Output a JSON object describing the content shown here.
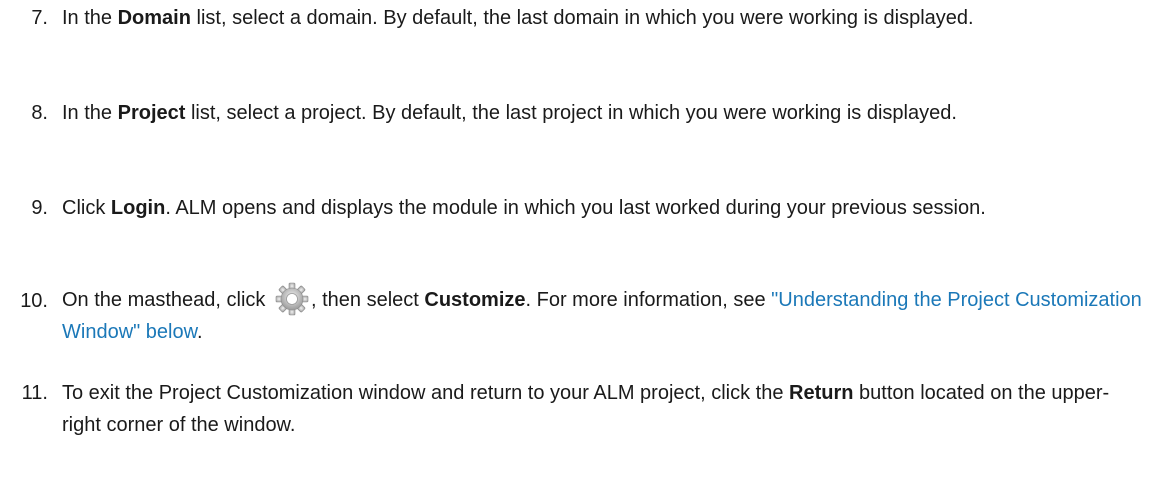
{
  "steps": [
    {
      "number": "7.",
      "parts": [
        "In the ",
        "Domain",
        " list, select a domain. By default, the last domain in which you were working is displayed."
      ]
    },
    {
      "number": "8.",
      "parts": [
        "In the ",
        "Project",
        " list, select a project. By default, the last project in which you were working is displayed."
      ]
    },
    {
      "number": "9.",
      "parts": [
        "Click ",
        "Login",
        ". ALM opens and displays the module in which you last worked during your previous session."
      ]
    },
    {
      "number": "10.",
      "parts": [
        "On the masthead, click ",
        ", then select ",
        "Customize",
        ". For more information, see ",
        "\"Understanding the Project Customization Window\" below",
        "."
      ],
      "icon": "gear-icon",
      "link_color": "#1b78b8"
    },
    {
      "number": "11.",
      "parts": [
        "To exit the Project Customization window and return to your ALM project, click the ",
        "Return",
        " button located on the upper-right corner of the window."
      ]
    }
  ]
}
